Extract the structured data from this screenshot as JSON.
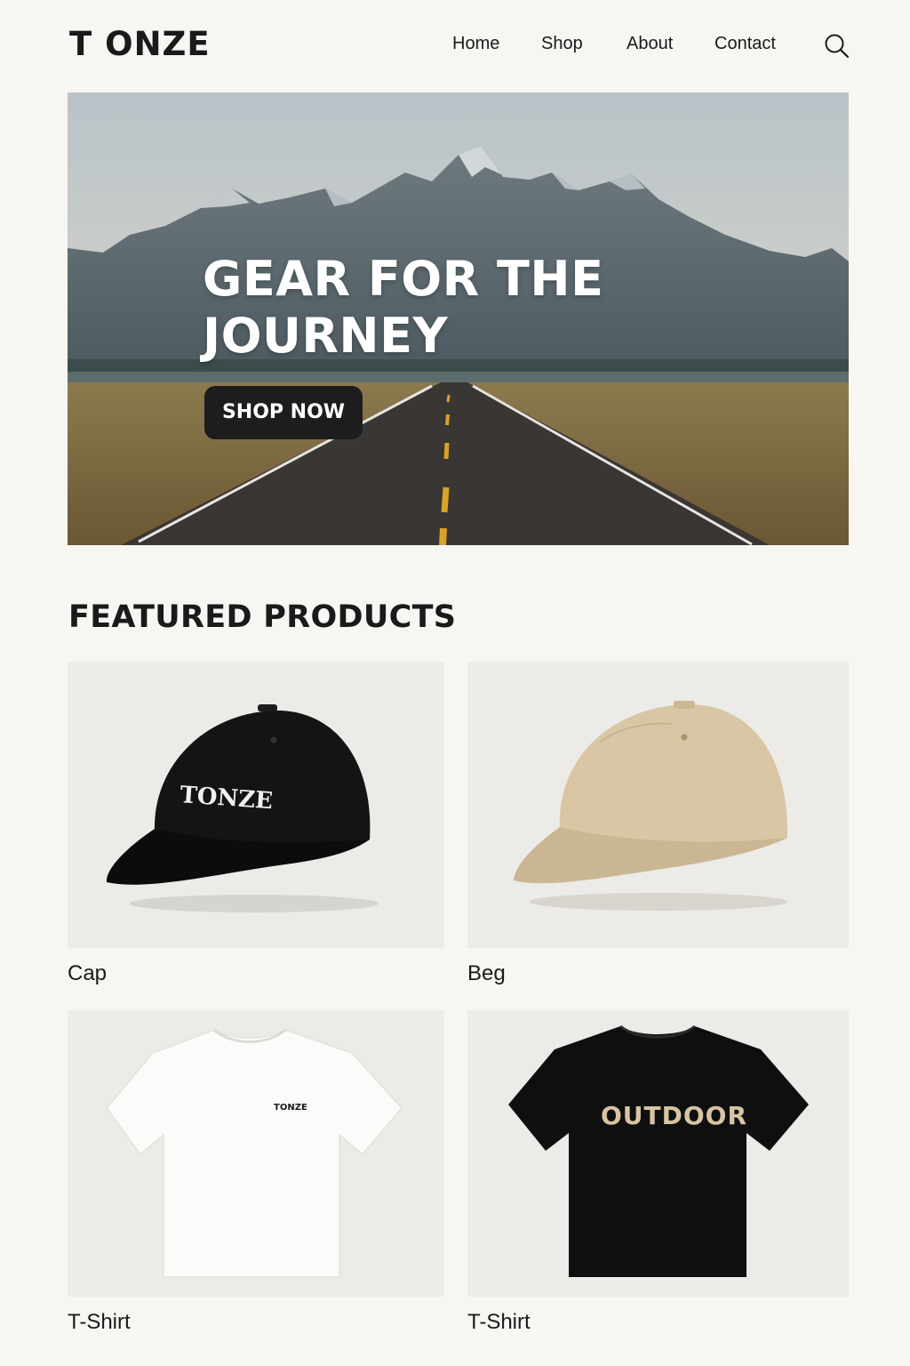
{
  "brand": {
    "logo": "T ONZE"
  },
  "nav": {
    "home": "Home",
    "shop": "Shop",
    "about": "About",
    "contact": "Contact",
    "search_icon": "search-icon"
  },
  "hero": {
    "title_line1": "GEAR FOR THE",
    "title_line2": "JOURNEY",
    "cta_label": "SHOP NOW"
  },
  "featured": {
    "title": "FEATURED PRODUCTS",
    "products": [
      {
        "name": "Cap",
        "print": "TONZE",
        "color": "#111111"
      },
      {
        "name": "Beg",
        "print": "",
        "color": "#d9c6a4"
      },
      {
        "name": "T-Shirt",
        "print": "TONZE",
        "color": "#fbfbf9"
      },
      {
        "name": "T-Shirt",
        "print": "OUTDOOR",
        "color": "#0f0f0f"
      }
    ]
  },
  "colors": {
    "background": "#f8f6f3",
    "text": "#1a1a1a",
    "button": "#1d1d1d",
    "outdoor_print": "#d6c4a3"
  }
}
